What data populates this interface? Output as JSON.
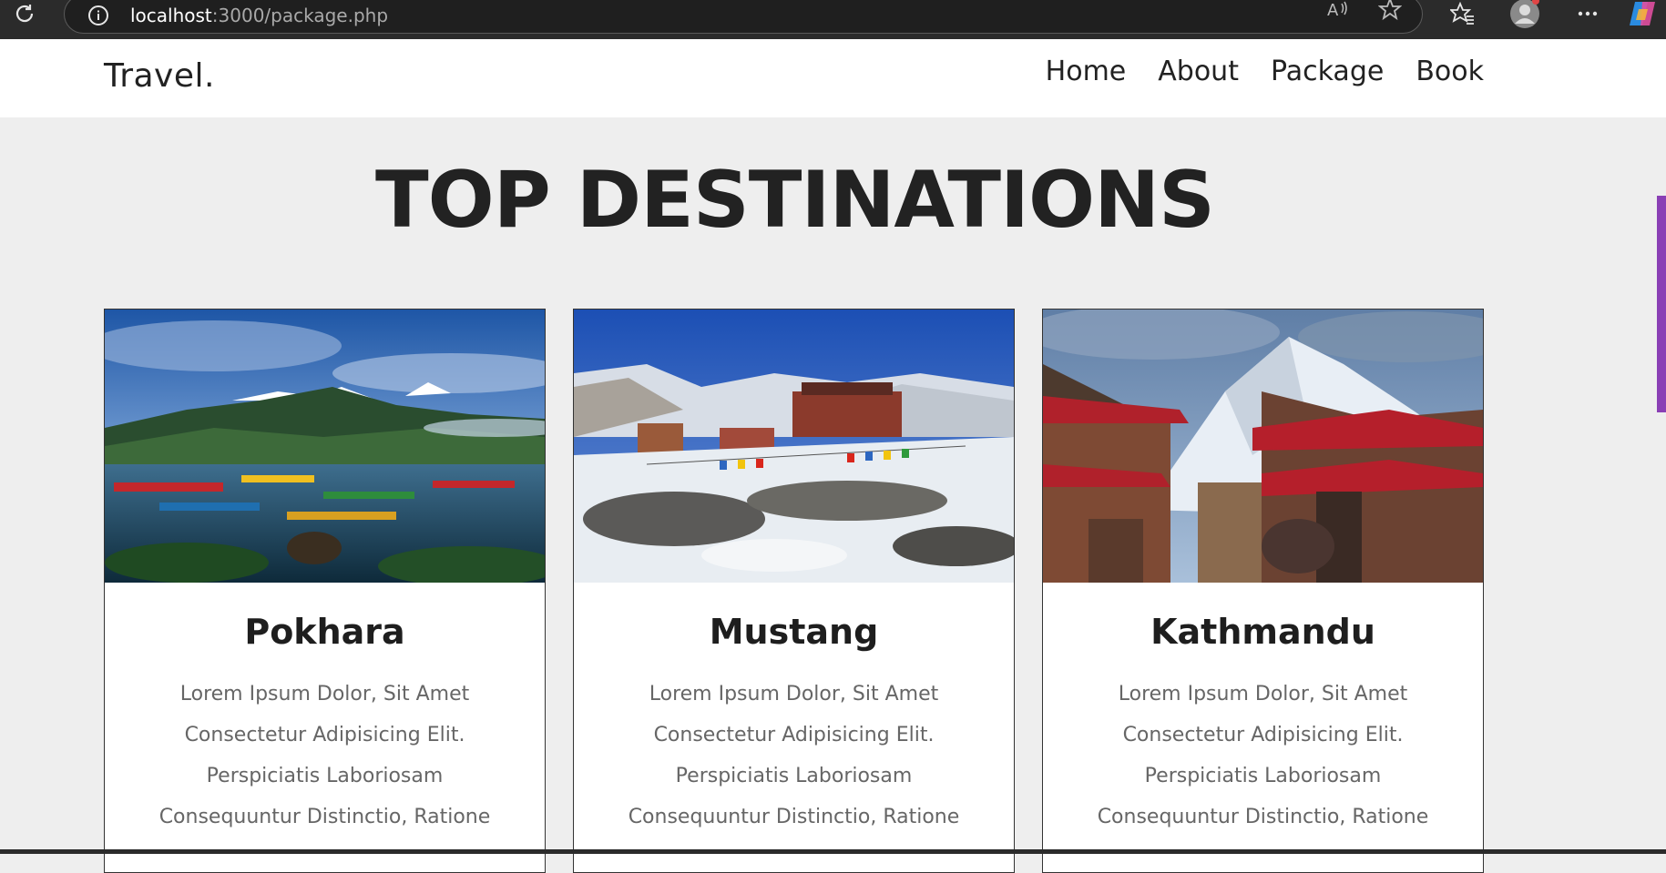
{
  "browser": {
    "url_host": "localhost",
    "url_path": ":3000/package.php"
  },
  "site": {
    "logo": "Travel.",
    "nav": [
      "Home",
      "About",
      "Package",
      "Book"
    ]
  },
  "main": {
    "heading": "TOP DESTINATIONS",
    "cards": [
      {
        "title": "Pokhara",
        "text": "Lorem Ipsum Dolor, Sit Amet Consectetur Adipisicing Elit. Perspiciatis Laboriosam Consequuntur Distinctio, Ratione"
      },
      {
        "title": "Mustang",
        "text": "Lorem Ipsum Dolor, Sit Amet Consectetur Adipisicing Elit. Perspiciatis Laboriosam Consequuntur Distinctio, Ratione"
      },
      {
        "title": "Kathmandu",
        "text": "Lorem Ipsum Dolor, Sit Amet Consectetur Adipisicing Elit. Perspiciatis Laboriosam Consequuntur Distinctio, Ratione"
      }
    ]
  },
  "icons": [
    "reload-icon",
    "info-icon",
    "read-aloud-icon",
    "favorite-star-icon",
    "favorites-icon",
    "profile-avatar-icon",
    "more-icon",
    "copilot-icon"
  ],
  "colors": {
    "browser_bg": "#2b2b2b",
    "page_bg": "#eeeeee",
    "text_dark": "#222222",
    "text_muted": "#666666",
    "accent": "#8a3fb5"
  }
}
